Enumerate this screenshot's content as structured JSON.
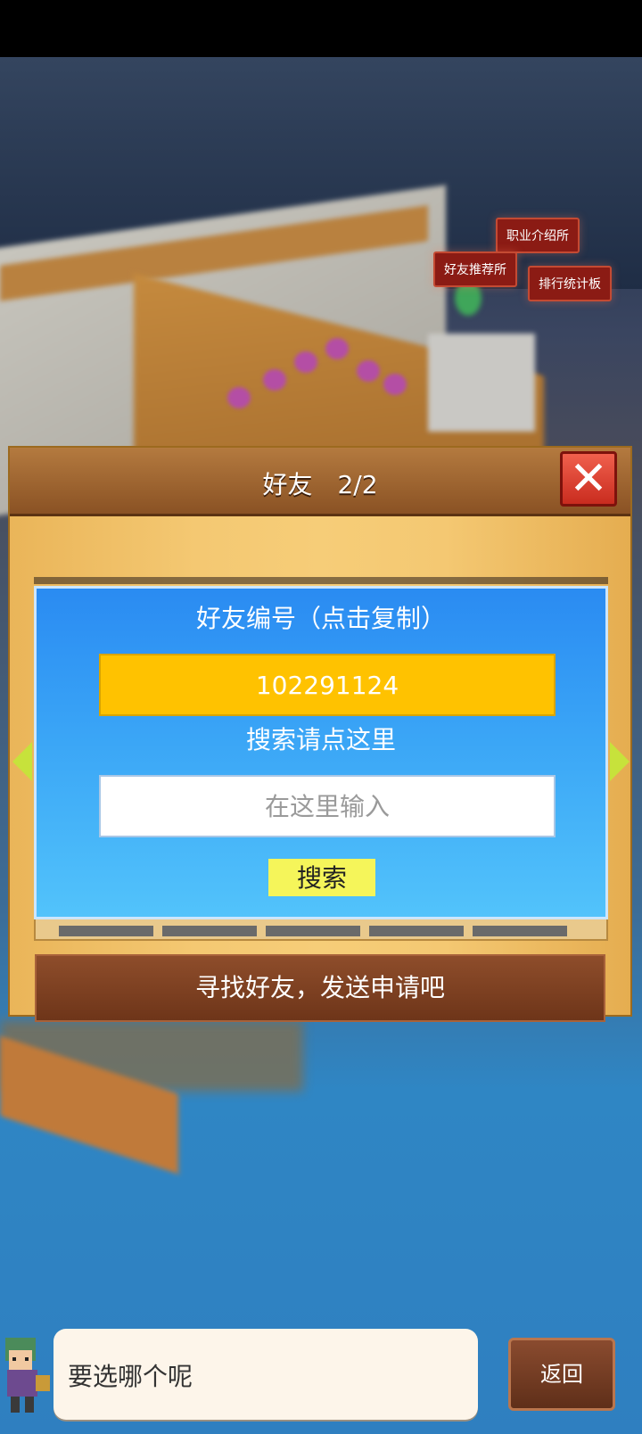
{
  "scene": {
    "signs": [
      "职业介绍所",
      "好友推荐所",
      "排行统计板"
    ]
  },
  "dialog": {
    "title": "好友　2/2",
    "close_icon": "close-x",
    "id_label": "好友编号（点击复制）",
    "friend_id": "102291124",
    "search_label": "搜索请点这里",
    "search_placeholder": "在这里输入",
    "search_button": "搜索",
    "send_label": "寻找好友，发送申请吧",
    "nav_left_icon": "arrow-left",
    "nav_right_icon": "arrow-right"
  },
  "hud": {
    "speech": "要选哪个呢",
    "back_label": "返回"
  },
  "colors": {
    "panel_blue": "#2a8bf2",
    "id_yellow": "#ffc200",
    "search_button": "#f5f55a",
    "close_red": "#e0473a",
    "wood": "#f4c872"
  }
}
